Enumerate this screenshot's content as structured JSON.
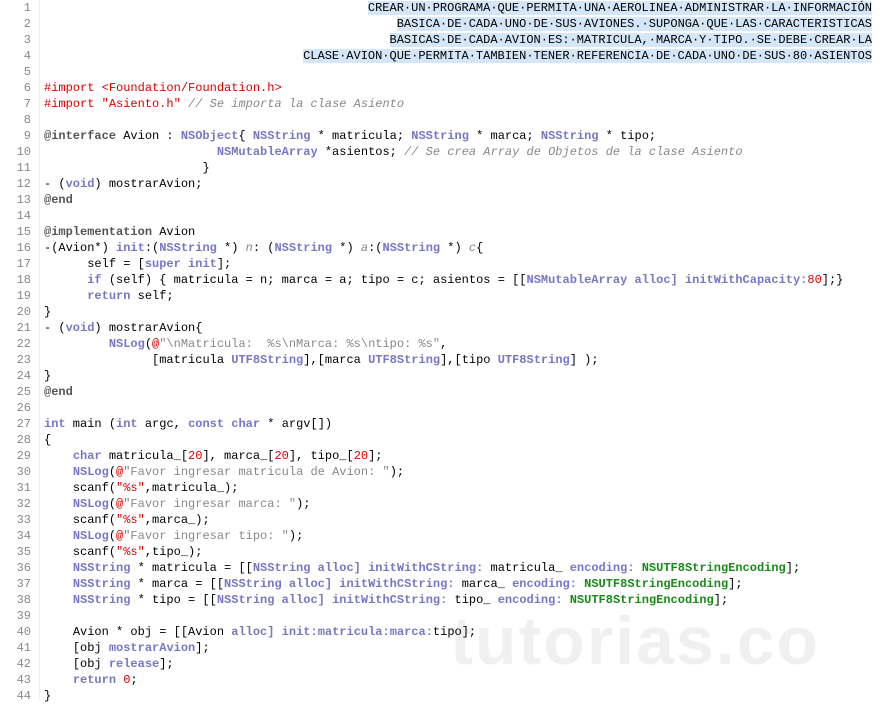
{
  "lineCount": 44,
  "watermark": "tutorias.co",
  "header": {
    "line1": "CREAR·UN·PROGRAMA·QUE·PERMITA·UNA·AEROLINEA·ADMINISTRAR·LA·INFORMACIÓN",
    "line2": "BASICA·DE·CADA·UNO·DE·SUS·AVIONES.·SUPONGA·QUE·LAS·CARACTERISTICAS",
    "line3": "BASICAS·DE·CADA·AVION·ES:·MATRICULA,·MARCA·Y·TIPO.·SE·DEBE·CREAR·LA",
    "line4": "CLASE·AVION·QUE·PERMITA·TAMBIEN·TENER·REFERENCIA·DE·CADA·UNO·DE·SUS·80·ASIENTOS"
  },
  "code": {
    "l6_import": "#import",
    "l6_path": "<Foundation/Foundation.h>",
    "l7_import": "#import",
    "l7_path": "\"Asiento.h\"",
    "l7_comment": "// Se importa la clase Asiento",
    "l9_interface": "@interface",
    "l9_avion": " Avion : ",
    "l9_nsobject": "NSObject",
    "l9_brace": "{ ",
    "l9_nsstring1": "NSString",
    "l9_mat": " * matricula; ",
    "l9_nsstring2": "NSString",
    "l9_marca": " * marca; ",
    "l9_nsstring3": "NSString",
    "l9_tipo": " * tipo;",
    "l10_nsmut": "NSMutableArray",
    "l10_asientos": " *asientos; ",
    "l10_comment": "// Se crea Array de Objetos de la clase Asiento",
    "l11_brace": "}",
    "l12_dash": "- (",
    "l12_void": "void",
    "l12_mostrar": ") mostrarAvion;",
    "l13_end": "@end",
    "l15_impl": "@implementation",
    "l15_avion": " Avion",
    "l16_avion": "-(Avion*) ",
    "l16_init": "init",
    "l16_colon1": ":(",
    "l16_ns1": "NSString",
    "l16_n": " *) ",
    "l16_nvar": "n",
    "l16_colon2": ": (",
    "l16_ns2": "NSString",
    "l16_a": " *) ",
    "l16_avar": "a",
    "l16_colon3": ":(",
    "l16_ns3": "NSString",
    "l16_c": " *) ",
    "l16_cvar": "c",
    "l16_brace": "{",
    "l17_self": "self = [",
    "l17_super": "super",
    "l17_init": " init",
    "l17_end": "];",
    "l18_if": "if",
    "l18_cond": " (self) { matricula = n; marca = a; tipo = c; asientos = [[",
    "l18_nsmut": "NSMutableArray",
    "l18_alloc": " alloc",
    "l18_init": "] initWithCapacity:",
    "l18_80": "80",
    "l18_end": "];}",
    "l19_return": "return",
    "l19_self": " self;",
    "l20_brace": "}",
    "l21_dash": "- (",
    "l21_void": "void",
    "l21_mostrar": ") mostrarAvion{",
    "l22_nslog": "NSLog",
    "l22_open": "(",
    "l22_at": "@",
    "l22_str": "\"\\nMatricula:  %s\\nMarca: %s\\ntipo: %s\"",
    "l22_comma": ",",
    "l23_open": "[matricula ",
    "l23_utf1": "UTF8String",
    "l23_mid1": "],[marca ",
    "l23_utf2": "UTF8String",
    "l23_mid2": "],[tipo ",
    "l23_utf3": "UTF8String",
    "l23_end": "] );",
    "l24_brace": "}",
    "l25_end": "@end",
    "l27_int": "int",
    "l27_main": " main (",
    "l27_int2": "int",
    "l27_argc": " argc, ",
    "l27_const": "const",
    "l27_char": " char",
    "l27_argv": " * argv[])",
    "l28_brace": "{",
    "l29_char": "char",
    "l29_vars": " matricula_[",
    "l29_20a": "20",
    "l29_mid1": "], marca_[",
    "l29_20b": "20",
    "l29_mid2": "], tipo_[",
    "l29_20c": "20",
    "l29_end": "];",
    "l30_nslog": "NSLog",
    "l30_open": "(",
    "l30_at": "@",
    "l30_str": "\"Favor ingresar matricula de Avion: \"",
    "l30_end": ");",
    "l31_scanf": "scanf(",
    "l31_fmt": "\"%s\"",
    "l31_end": ",matricula_);",
    "l32_nslog": "NSLog",
    "l32_open": "(",
    "l32_at": "@",
    "l32_str": "\"Favor ingresar marca: \"",
    "l32_end": ");",
    "l33_scanf": "scanf(",
    "l33_fmt": "\"%s\"",
    "l33_end": ",marca_);",
    "l34_nslog": "NSLog",
    "l34_open": "(",
    "l34_at": "@",
    "l34_str": "\"Favor ingresar tipo: \"",
    "l34_end": ");",
    "l35_scanf": "scanf(",
    "l35_fmt": "\"%s\"",
    "l35_end": ",tipo_);",
    "l36_ns": "NSString",
    "l36_mat": " * matricula = [[",
    "l36_ns2": "NSString",
    "l36_alloc": " alloc",
    "l36_init": "] initWithCString:",
    "l36_var": " matricula_ ",
    "l36_enc": "encoding:",
    "l36_utf": " NSUTF8StringEncoding",
    "l36_end": "];",
    "l37_ns": "NSString",
    "l37_mat": " * marca = [[",
    "l37_ns2": "NSString",
    "l37_alloc": " alloc",
    "l37_init": "] initWithCString:",
    "l37_var": " marca_ ",
    "l37_enc": "encoding:",
    "l37_utf": " NSUTF8StringEncoding",
    "l37_end": "];",
    "l38_ns": "NSString",
    "l38_mat": " * tipo = [[",
    "l38_ns2": "NSString",
    "l38_alloc": " alloc",
    "l38_init": "] initWithCString:",
    "l38_var": " tipo_ ",
    "l38_enc": "encoding:",
    "l38_utf": " NSUTF8StringEncoding",
    "l38_end": "];",
    "l40_avion": "Avion * obj = [[Avion ",
    "l40_alloc": "alloc",
    "l40_init": "] init:",
    "l40_mat": "matricula:",
    "l40_marca": "marca:",
    "l40_tipo": "tipo];",
    "l41_obj": "[obj ",
    "l41_mostrar": "mostrarAvion",
    "l41_end": "];",
    "l42_obj": "[obj ",
    "l42_release": "release",
    "l42_end": "];",
    "l43_return": "return",
    "l43_zero": " 0",
    "l43_end": ";",
    "l44_brace": "}"
  }
}
